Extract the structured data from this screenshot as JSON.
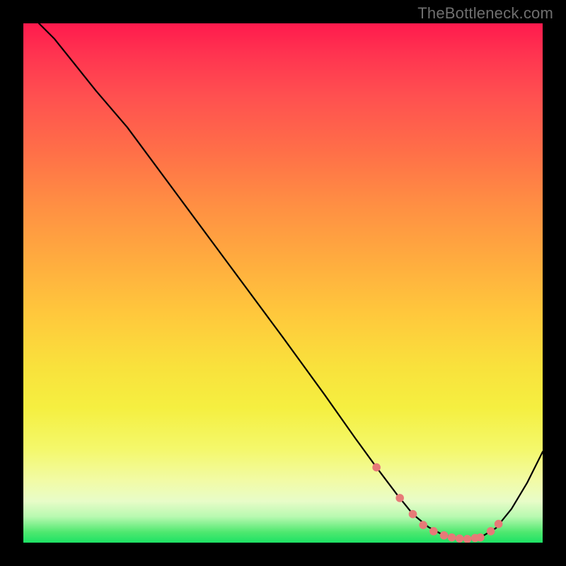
{
  "attribution": "TheBottleneck.com",
  "colors": {
    "dot": "#e77a78",
    "curve": "#000000"
  },
  "chart_data": {
    "type": "line",
    "title": "",
    "xlabel": "",
    "ylabel": "",
    "xlim": [
      0,
      100
    ],
    "ylim": [
      0,
      100
    ],
    "grid": false,
    "legend": false,
    "series": [
      {
        "name": "curve",
        "x": [
          3,
          6,
          10,
          14,
          20,
          30,
          40,
          50,
          58,
          64,
          68,
          72,
          75,
          78,
          81,
          84,
          86,
          88,
          91,
          94,
          97,
          100
        ],
        "y": [
          100,
          97,
          92,
          87,
          80,
          66.5,
          53,
          39.5,
          28.5,
          20,
          14.5,
          9.2,
          5.5,
          3,
          1.4,
          0.8,
          0.7,
          1.0,
          2.8,
          6.5,
          11.5,
          17.5
        ]
      }
    ],
    "highlight_dots": {
      "name": "flat-region-dots",
      "x": [
        68,
        72.5,
        75,
        77,
        79,
        81,
        82.5,
        84,
        85.5,
        87,
        88,
        90,
        91.5
      ],
      "y": [
        14.5,
        8.6,
        5.5,
        3.4,
        2.2,
        1.4,
        1.0,
        0.8,
        0.7,
        0.9,
        1.0,
        2.2,
        3.6
      ]
    }
  }
}
